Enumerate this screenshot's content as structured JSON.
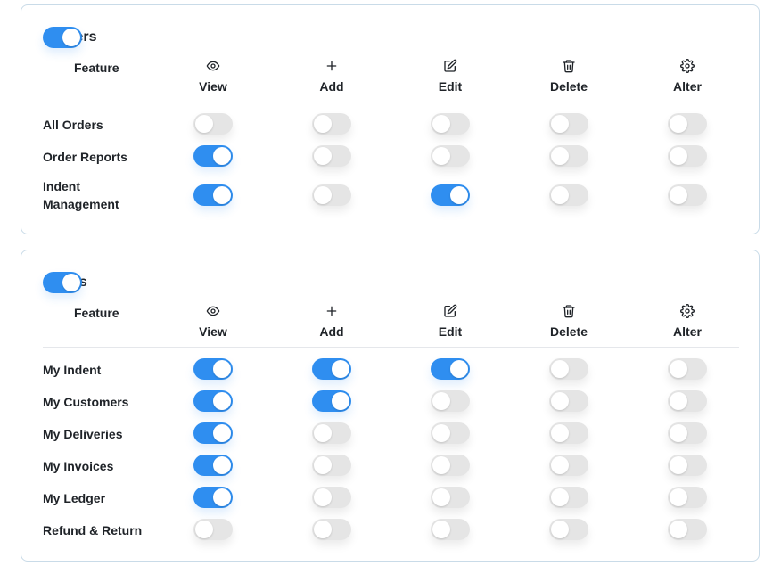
{
  "sections": [
    {
      "title": "Orders",
      "enabled": true,
      "feature_header": "Feature",
      "columns": [
        {
          "label": "View",
          "icon": "eye-icon"
        },
        {
          "label": "Add",
          "icon": "plus-icon"
        },
        {
          "label": "Edit",
          "icon": "edit-icon"
        },
        {
          "label": "Delete",
          "icon": "trash-icon"
        },
        {
          "label": "Alter",
          "icon": "gear-icon"
        }
      ],
      "rows": [
        {
          "label": "All Orders",
          "perms": [
            false,
            false,
            false,
            false,
            false
          ]
        },
        {
          "label": "Order Reports",
          "perms": [
            true,
            false,
            false,
            false,
            false
          ]
        },
        {
          "label": "Indent Management",
          "perms": [
            true,
            false,
            true,
            false,
            false
          ]
        }
      ]
    },
    {
      "title": "Sales",
      "enabled": true,
      "feature_header": "Feature",
      "columns": [
        {
          "label": "View",
          "icon": "eye-icon"
        },
        {
          "label": "Add",
          "icon": "plus-icon"
        },
        {
          "label": "Edit",
          "icon": "edit-icon"
        },
        {
          "label": "Delete",
          "icon": "trash-icon"
        },
        {
          "label": "Alter",
          "icon": "gear-icon"
        }
      ],
      "rows": [
        {
          "label": "My Indent",
          "perms": [
            true,
            true,
            true,
            false,
            false
          ]
        },
        {
          "label": "My Customers",
          "perms": [
            true,
            true,
            false,
            false,
            false
          ]
        },
        {
          "label": "My Deliveries",
          "perms": [
            true,
            false,
            false,
            false,
            false
          ]
        },
        {
          "label": "My Invoices",
          "perms": [
            true,
            false,
            false,
            false,
            false
          ]
        },
        {
          "label": "My Ledger",
          "perms": [
            true,
            false,
            false,
            false,
            false
          ]
        },
        {
          "label": "Refund & Return",
          "perms": [
            false,
            false,
            false,
            false,
            false
          ]
        }
      ]
    }
  ],
  "colors": {
    "toggle_on": "#2f8ef0",
    "toggle_off": "#e5e5e5",
    "card_border": "#c9dbe8"
  }
}
